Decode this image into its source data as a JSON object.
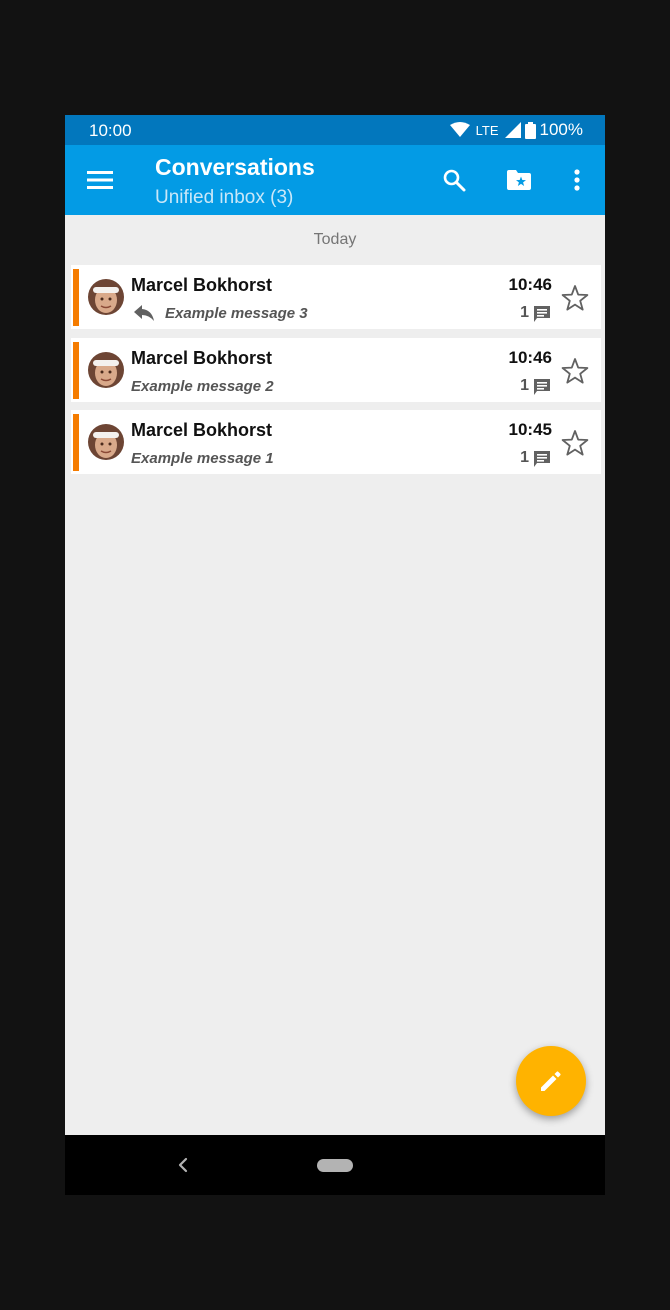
{
  "status_bar": {
    "time": "10:00",
    "network": "LTE",
    "battery": "100%",
    "icons": [
      "wifi-icon",
      "signal-icon",
      "battery-icon"
    ]
  },
  "toolbar": {
    "title": "Conversations",
    "subtitle": "Unified inbox (3)",
    "actions": [
      "menu-icon",
      "search-icon",
      "starred-folder-icon",
      "more-vert-icon"
    ]
  },
  "list": {
    "section_header": "Today",
    "conversations": [
      {
        "sender": "Marcel Bokhorst",
        "subject": "Example message 3",
        "time": "10:46",
        "count": "1",
        "replied": true,
        "starred": false
      },
      {
        "sender": "Marcel Bokhorst",
        "subject": "Example message 2",
        "time": "10:46",
        "count": "1",
        "replied": false,
        "starred": false
      },
      {
        "sender": "Marcel Bokhorst",
        "subject": "Example message 1",
        "time": "10:45",
        "count": "1",
        "replied": false,
        "starred": false
      }
    ]
  },
  "fab": {
    "icon": "pencil-icon"
  },
  "nav_bar": {
    "buttons": [
      "back-icon",
      "home-pill"
    ]
  },
  "colors": {
    "status_bar": "#0277bd",
    "toolbar": "#039be5",
    "accent_bar": "#f57c00",
    "fab": "#ffb300",
    "background": "#eeeeee"
  }
}
